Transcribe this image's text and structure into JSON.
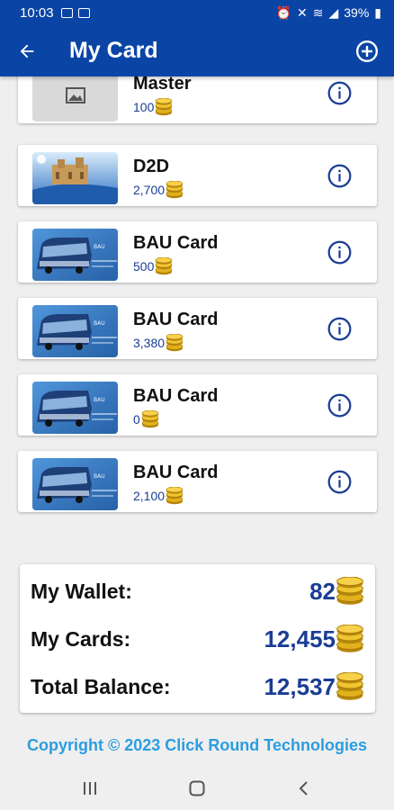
{
  "status": {
    "time": "10:03",
    "battery": "39%"
  },
  "header": {
    "title": "My Card"
  },
  "cards": [
    {
      "name": "Master",
      "value": "100"
    },
    {
      "name": "D2D",
      "value": "2,700"
    },
    {
      "name": "BAU Card",
      "value": "500"
    },
    {
      "name": "BAU Card",
      "value": "3,380"
    },
    {
      "name": "BAU Card",
      "value": "0"
    },
    {
      "name": "BAU Card",
      "value": "2,100"
    }
  ],
  "summary": {
    "wallet_label": "My Wallet:",
    "wallet_value": "82",
    "cards_label": "My Cards:",
    "cards_value": "12,455",
    "total_label": "Total Balance:",
    "total_value": "12,537"
  },
  "footer": {
    "copyright": "Copyright © 2023 Click Round Technologies"
  },
  "colors": {
    "primary": "#0a45a6",
    "accent_text": "#1a3d94",
    "copyright": "#2a9de0"
  },
  "icons": [
    "back-arrow-icon",
    "add-circle-icon",
    "info-icon",
    "coin-stack-icon"
  ]
}
